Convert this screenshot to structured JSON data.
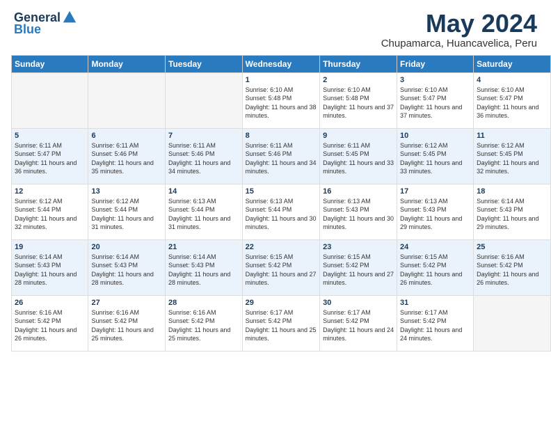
{
  "header": {
    "logo_general": "General",
    "logo_blue": "Blue",
    "month_title": "May 2024",
    "subtitle": "Chupamarca, Huancavelica, Peru"
  },
  "columns": [
    "Sunday",
    "Monday",
    "Tuesday",
    "Wednesday",
    "Thursday",
    "Friday",
    "Saturday"
  ],
  "weeks": [
    [
      {
        "day": "",
        "empty": true
      },
      {
        "day": "",
        "empty": true
      },
      {
        "day": "",
        "empty": true
      },
      {
        "day": "1",
        "sunrise": "6:10 AM",
        "sunset": "5:48 PM",
        "daylight": "11 hours and 38 minutes."
      },
      {
        "day": "2",
        "sunrise": "6:10 AM",
        "sunset": "5:48 PM",
        "daylight": "11 hours and 37 minutes."
      },
      {
        "day": "3",
        "sunrise": "6:10 AM",
        "sunset": "5:47 PM",
        "daylight": "11 hours and 37 minutes."
      },
      {
        "day": "4",
        "sunrise": "6:10 AM",
        "sunset": "5:47 PM",
        "daylight": "11 hours and 36 minutes."
      }
    ],
    [
      {
        "day": "5",
        "sunrise": "6:11 AM",
        "sunset": "5:47 PM",
        "daylight": "11 hours and 36 minutes."
      },
      {
        "day": "6",
        "sunrise": "6:11 AM",
        "sunset": "5:46 PM",
        "daylight": "11 hours and 35 minutes."
      },
      {
        "day": "7",
        "sunrise": "6:11 AM",
        "sunset": "5:46 PM",
        "daylight": "11 hours and 34 minutes."
      },
      {
        "day": "8",
        "sunrise": "6:11 AM",
        "sunset": "5:46 PM",
        "daylight": "11 hours and 34 minutes."
      },
      {
        "day": "9",
        "sunrise": "6:11 AM",
        "sunset": "5:45 PM",
        "daylight": "11 hours and 33 minutes."
      },
      {
        "day": "10",
        "sunrise": "6:12 AM",
        "sunset": "5:45 PM",
        "daylight": "11 hours and 33 minutes."
      },
      {
        "day": "11",
        "sunrise": "6:12 AM",
        "sunset": "5:45 PM",
        "daylight": "11 hours and 32 minutes."
      }
    ],
    [
      {
        "day": "12",
        "sunrise": "6:12 AM",
        "sunset": "5:44 PM",
        "daylight": "11 hours and 32 minutes."
      },
      {
        "day": "13",
        "sunrise": "6:12 AM",
        "sunset": "5:44 PM",
        "daylight": "11 hours and 31 minutes."
      },
      {
        "day": "14",
        "sunrise": "6:13 AM",
        "sunset": "5:44 PM",
        "daylight": "11 hours and 31 minutes."
      },
      {
        "day": "15",
        "sunrise": "6:13 AM",
        "sunset": "5:44 PM",
        "daylight": "11 hours and 30 minutes."
      },
      {
        "day": "16",
        "sunrise": "6:13 AM",
        "sunset": "5:43 PM",
        "daylight": "11 hours and 30 minutes."
      },
      {
        "day": "17",
        "sunrise": "6:13 AM",
        "sunset": "5:43 PM",
        "daylight": "11 hours and 29 minutes."
      },
      {
        "day": "18",
        "sunrise": "6:14 AM",
        "sunset": "5:43 PM",
        "daylight": "11 hours and 29 minutes."
      }
    ],
    [
      {
        "day": "19",
        "sunrise": "6:14 AM",
        "sunset": "5:43 PM",
        "daylight": "11 hours and 28 minutes."
      },
      {
        "day": "20",
        "sunrise": "6:14 AM",
        "sunset": "5:43 PM",
        "daylight": "11 hours and 28 minutes."
      },
      {
        "day": "21",
        "sunrise": "6:14 AM",
        "sunset": "5:43 PM",
        "daylight": "11 hours and 28 minutes."
      },
      {
        "day": "22",
        "sunrise": "6:15 AM",
        "sunset": "5:42 PM",
        "daylight": "11 hours and 27 minutes."
      },
      {
        "day": "23",
        "sunrise": "6:15 AM",
        "sunset": "5:42 PM",
        "daylight": "11 hours and 27 minutes."
      },
      {
        "day": "24",
        "sunrise": "6:15 AM",
        "sunset": "5:42 PM",
        "daylight": "11 hours and 26 minutes."
      },
      {
        "day": "25",
        "sunrise": "6:16 AM",
        "sunset": "5:42 PM",
        "daylight": "11 hours and 26 minutes."
      }
    ],
    [
      {
        "day": "26",
        "sunrise": "6:16 AM",
        "sunset": "5:42 PM",
        "daylight": "11 hours and 26 minutes."
      },
      {
        "day": "27",
        "sunrise": "6:16 AM",
        "sunset": "5:42 PM",
        "daylight": "11 hours and 25 minutes."
      },
      {
        "day": "28",
        "sunrise": "6:16 AM",
        "sunset": "5:42 PM",
        "daylight": "11 hours and 25 minutes."
      },
      {
        "day": "29",
        "sunrise": "6:17 AM",
        "sunset": "5:42 PM",
        "daylight": "11 hours and 25 minutes."
      },
      {
        "day": "30",
        "sunrise": "6:17 AM",
        "sunset": "5:42 PM",
        "daylight": "11 hours and 24 minutes."
      },
      {
        "day": "31",
        "sunrise": "6:17 AM",
        "sunset": "5:42 PM",
        "daylight": "11 hours and 24 minutes."
      },
      {
        "day": "",
        "empty": true
      }
    ]
  ]
}
